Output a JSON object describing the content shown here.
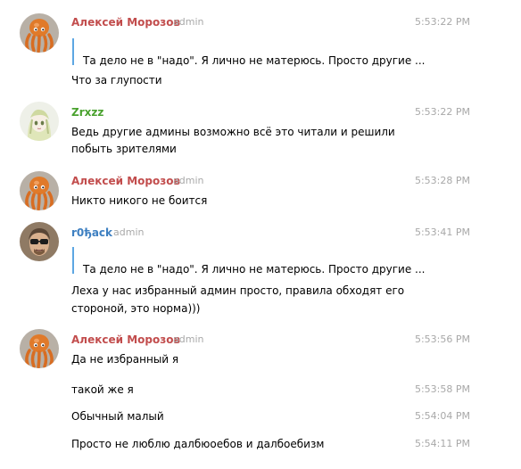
{
  "colors": {
    "name_red": "#c24d4d",
    "name_green": "#4aa22f",
    "name_blue": "#3d7fc1",
    "reply_bar": "#5da7e3",
    "meta_gray": "#a8a8a8"
  },
  "messages": [
    {
      "author": "Алексей Морозов",
      "badge": "admin",
      "avatar": "octopus-avatar",
      "time": "5:53:22 PM",
      "reply_preview": "Та дело не в \"надо\". Я лично не матерюсь. Просто другие ...",
      "lines": [
        "Что за глупости"
      ]
    },
    {
      "author": "Zrxzz",
      "avatar": "anime-girl-avatar",
      "time": "5:53:22 PM",
      "lines": [
        "Ведь другие админы возможно всё это читали и решили",
        "побыть зрителями"
      ]
    },
    {
      "author": "Алексей Морозов",
      "badge": "admin",
      "avatar": "octopus-avatar",
      "time": "5:53:28 PM",
      "lines": [
        "Никто никого не боится"
      ]
    },
    {
      "author": "r0ђack",
      "badge": "admin",
      "avatar": "sunglasses-man-avatar",
      "time": "5:53:41 PM",
      "reply_preview": "Та дело не в \"надо\". Я лично не матерюсь. Просто другие ...",
      "lines": [
        "Леха у нас избранный админ просто, правила обходят его",
        "стороной, это норма)))"
      ]
    },
    {
      "author": "Алексей Морозов",
      "badge": "admin",
      "avatar": "octopus-avatar",
      "time": "5:53:56 PM",
      "lines": [
        "Да не избранный я"
      ]
    },
    {
      "time": "5:53:58 PM",
      "lines": [
        "такой же я"
      ]
    },
    {
      "time": "5:54:04 PM",
      "lines": [
        "Обычный малый"
      ]
    },
    {
      "time": "5:54:11 PM",
      "lines": [
        "Просто не люблю далбюоебов и далбоебизм"
      ]
    }
  ]
}
